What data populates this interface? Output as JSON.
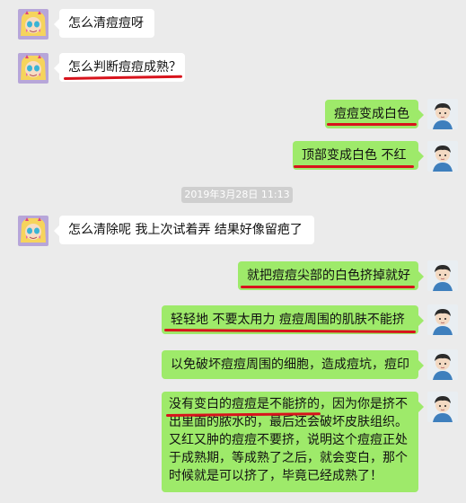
{
  "timestamp": "2019年3月28日 11:13",
  "messages": [
    {
      "side": "left",
      "text": "怎么清痘痘呀"
    },
    {
      "side": "left",
      "text": "怎么判断痘痘成熟？"
    },
    {
      "side": "right",
      "text": "痘痘变成白色"
    },
    {
      "side": "right",
      "text": "顶部变成白色  不红"
    },
    {
      "side": "left",
      "text": "怎么清除呢 我上次试着弄 结果好像留疤了"
    },
    {
      "side": "right",
      "text": "就把痘痘尖部的白色挤掉就好"
    },
    {
      "side": "right",
      "text": "轻轻地  不要太用力  痘痘周围的肌肤不能挤"
    },
    {
      "side": "right",
      "text": "以免破坏痘痘周围的细胞，造成痘坑，痘印"
    },
    {
      "side": "right",
      "lines": [
        "没有变白的痘痘是不能挤的，因为你是挤不",
        "出里面的脓水的，最后还会破坏皮肤组织。",
        "又红又肿的痘痘不要挤，说明这个痘痘正处",
        "于成熟期，等成熟了之后，就会变白，那个",
        "时候就是可以挤了，毕竟已经成熟了！"
      ]
    }
  ],
  "colors": {
    "background": "#ebebeb",
    "bubble_left": "#ffffff",
    "bubble_right": "#9eea6a",
    "annotation_red": "#d8131c"
  },
  "icons": {
    "left_avatar": "cartoon-girl-avatar",
    "right_avatar": "cartoon-boy-avatar"
  }
}
